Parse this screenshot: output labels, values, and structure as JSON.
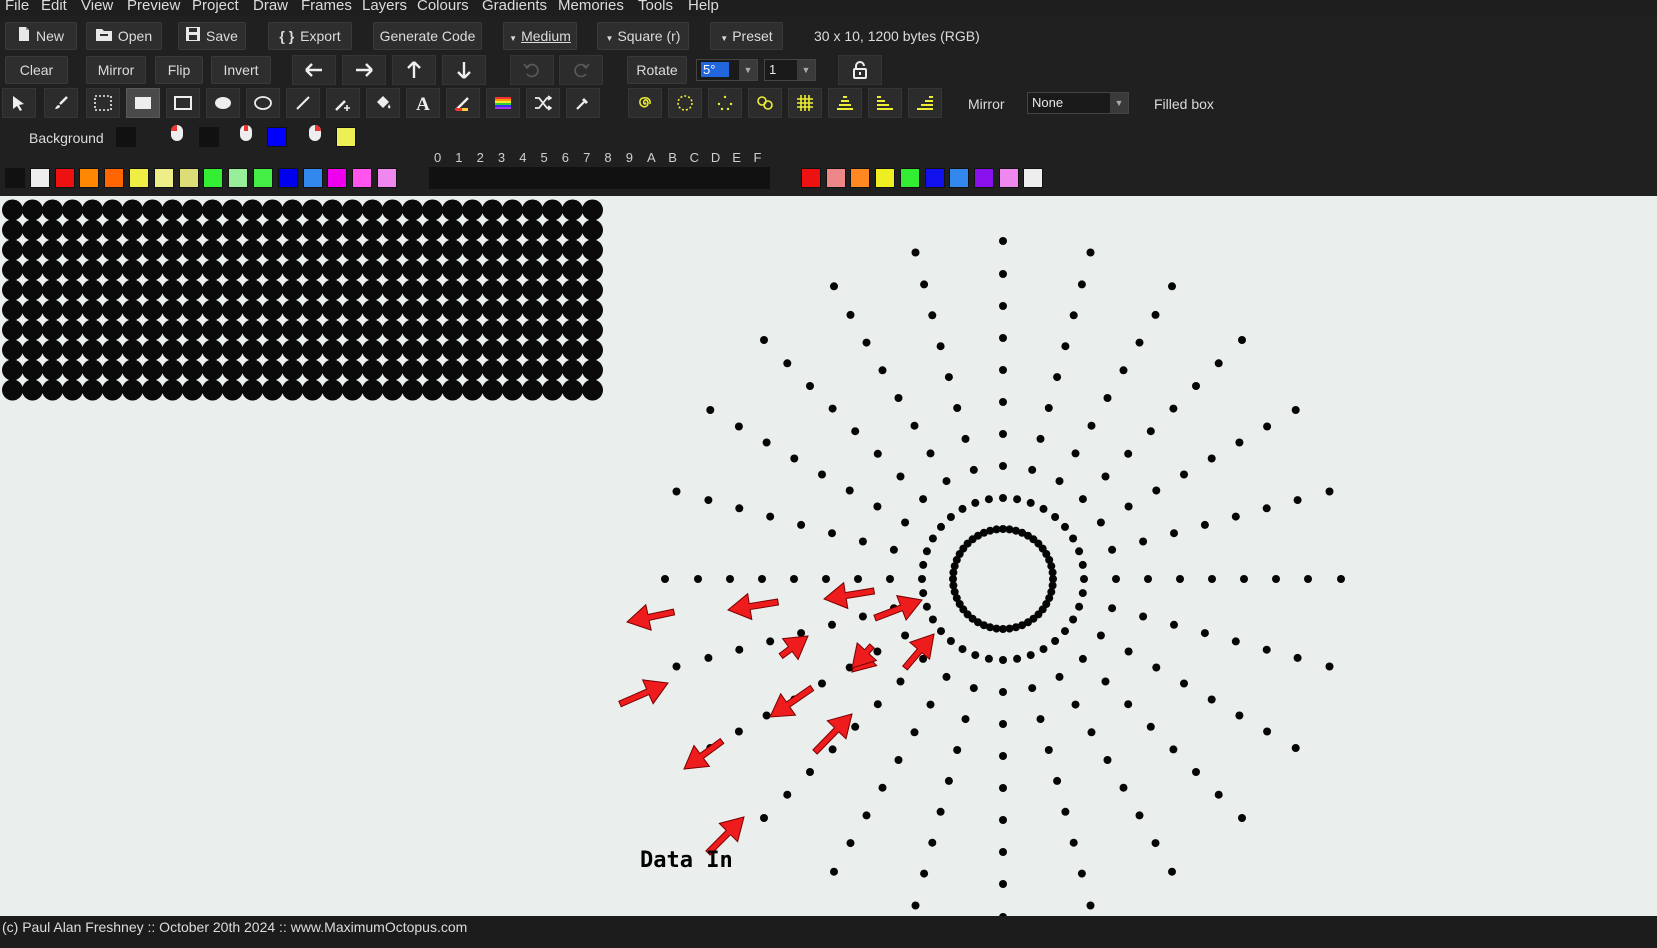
{
  "menu": [
    "File",
    "Edit",
    "View",
    "Preview",
    "Project",
    "Draw",
    "Frames",
    "Layers",
    "Colours",
    "Gradients",
    "Memories",
    "Tools",
    "Help"
  ],
  "toolbar1": {
    "new": "New",
    "open": "Open",
    "save": "Save",
    "export": "Export",
    "generate_code": "Generate Code",
    "medium": "Medium",
    "square": "Square (r)",
    "preset": "Preset",
    "matrix_info": "30 x 10, 1200 bytes (RGB)"
  },
  "toolbar2": {
    "clear": "Clear",
    "mirror": "Mirror",
    "flip": "Flip",
    "invert": "Invert",
    "rotate": "Rotate",
    "rotate_angle": "5°",
    "rotate_count": "1"
  },
  "toolbar3": {
    "mirror_label": "Mirror",
    "mirror_value": "None",
    "filled_box": "Filled box"
  },
  "colours": {
    "background_label": "Background",
    "background": "#111111",
    "left_mouse": "#111111",
    "middle_mouse": "#0000ff",
    "right_mouse": "#eeee55",
    "palette": [
      "#111111",
      "#eeeeee",
      "#ee1111",
      "#ff8800",
      "#ff6600",
      "#eeee44",
      "#eeee88",
      "#dddd77",
      "#33ee33",
      "#99ee99",
      "#44ee44",
      "#0000ee",
      "#3388ee",
      "#ee00ee",
      "#ff55ee",
      "#ee88ee"
    ],
    "hex_labels": [
      "0",
      "1",
      "2",
      "3",
      "4",
      "5",
      "6",
      "7",
      "8",
      "9",
      "A",
      "B",
      "C",
      "D",
      "E",
      "F"
    ],
    "gradient_palette": [
      "#ee1111",
      "#ee8888",
      "#ff8822",
      "#eeee22",
      "#33ee33",
      "#1111ee",
      "#3388ee",
      "#8811ee",
      "#ee88ee",
      "#eeeeee"
    ]
  },
  "preview": {
    "columns": 30,
    "rows": 10
  },
  "annotation": {
    "label": "Data In"
  },
  "status": "(c) Paul Alan Freshney :: October 20th 2024 :: www.MaximumOctopus.com"
}
